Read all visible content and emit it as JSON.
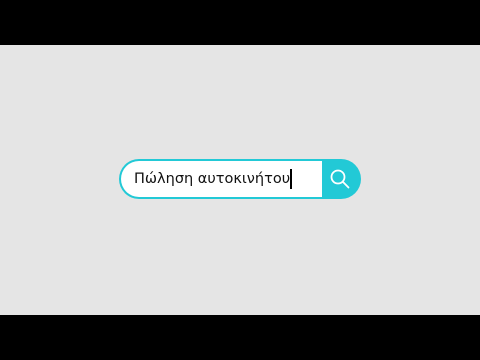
{
  "search": {
    "query": "Πώληση αυτοκινήτου",
    "icon": "search-icon"
  },
  "colors": {
    "accent": "#22c9d6",
    "background": "#e5e5e5",
    "letterbox": "#000000",
    "input_bg": "#ffffff"
  }
}
